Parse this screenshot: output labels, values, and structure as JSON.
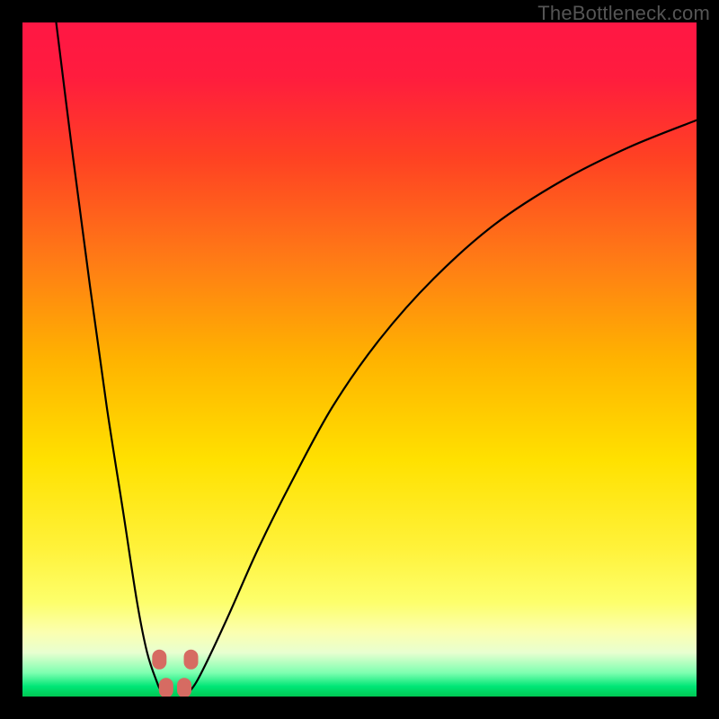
{
  "watermark": "TheBottleneck.com",
  "chart_data": {
    "type": "line",
    "title": "",
    "xlabel": "",
    "ylabel": "",
    "xlim": [
      0,
      100
    ],
    "ylim": [
      0,
      100
    ],
    "series": [
      {
        "name": "left-curve",
        "x": [
          5,
          7.5,
          10,
          12.5,
          15,
          17.0,
          18.5,
          20.0,
          20.5,
          21.0
        ],
        "y": [
          100,
          80,
          61,
          43,
          27,
          14,
          6.5,
          2.0,
          1.0,
          0.5
        ]
      },
      {
        "name": "right-curve",
        "x": [
          24.5,
          25.0,
          26,
          28,
          31,
          35,
          40,
          46,
          53,
          61,
          70,
          80,
          90,
          100
        ],
        "y": [
          0.5,
          1.0,
          2.5,
          6.5,
          13,
          22,
          32,
          43,
          53,
          62,
          70,
          76.5,
          81.5,
          85.5
        ]
      }
    ],
    "markers": [
      {
        "name": "marker-left-top",
        "x": 20.3,
        "y": 5.5
      },
      {
        "name": "marker-right-top",
        "x": 25.0,
        "y": 5.5
      },
      {
        "name": "marker-bottom-left",
        "x": 21.3,
        "y": 1.3
      },
      {
        "name": "marker-bottom-right",
        "x": 24.0,
        "y": 1.3
      }
    ],
    "gradient_stops": [
      {
        "offset": 0.0,
        "color": "#ff1744"
      },
      {
        "offset": 0.08,
        "color": "#ff1c3e"
      },
      {
        "offset": 0.2,
        "color": "#ff4123"
      },
      {
        "offset": 0.35,
        "color": "#ff7a16"
      },
      {
        "offset": 0.5,
        "color": "#ffb300"
      },
      {
        "offset": 0.65,
        "color": "#ffe100"
      },
      {
        "offset": 0.78,
        "color": "#fff23a"
      },
      {
        "offset": 0.86,
        "color": "#fdff6b"
      },
      {
        "offset": 0.905,
        "color": "#fbffb0"
      },
      {
        "offset": 0.935,
        "color": "#e8ffd0"
      },
      {
        "offset": 0.965,
        "color": "#7dffb0"
      },
      {
        "offset": 0.985,
        "color": "#00e676"
      },
      {
        "offset": 1.0,
        "color": "#00c853"
      }
    ],
    "marker_color": "#d66b62",
    "curve_color": "#000000"
  }
}
